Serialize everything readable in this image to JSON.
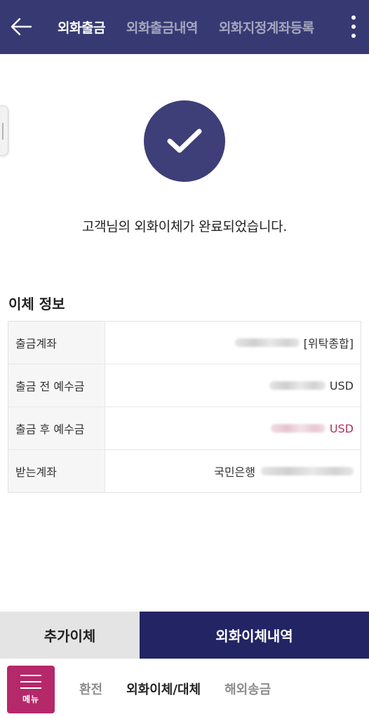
{
  "header": {
    "tabs": [
      {
        "label": "외화출금",
        "active": true
      },
      {
        "label": "외화출금내역",
        "active": false
      },
      {
        "label": "외화지정계좌등록",
        "active": false
      }
    ]
  },
  "result": {
    "message": "고객님의 외화이체가 완료되었습니다."
  },
  "transfer_info": {
    "title": "이체 정보",
    "rows": [
      {
        "label": "출금계좌",
        "value_suffix": "[위탁종합]"
      },
      {
        "label": "출금 전 예수금",
        "value_suffix": "USD"
      },
      {
        "label": "출금 후 예수금",
        "value_suffix": "USD"
      },
      {
        "label": "받는계좌",
        "value_prefix": "국민은행"
      }
    ]
  },
  "actions": {
    "additional_transfer": "추가이체",
    "history": "외화이체내역"
  },
  "bottom_nav": {
    "menu_label": "메뉴",
    "items": [
      {
        "label": "환전",
        "active": false
      },
      {
        "label": "외화이체/대체",
        "active": true
      },
      {
        "label": "해외송금",
        "active": false
      }
    ]
  },
  "colors": {
    "header_bg": "#373a72",
    "check_circle": "#3e3e78",
    "primary_button": "#232464",
    "menu_button": "#b5286a",
    "negative_value": "#b0305f"
  }
}
